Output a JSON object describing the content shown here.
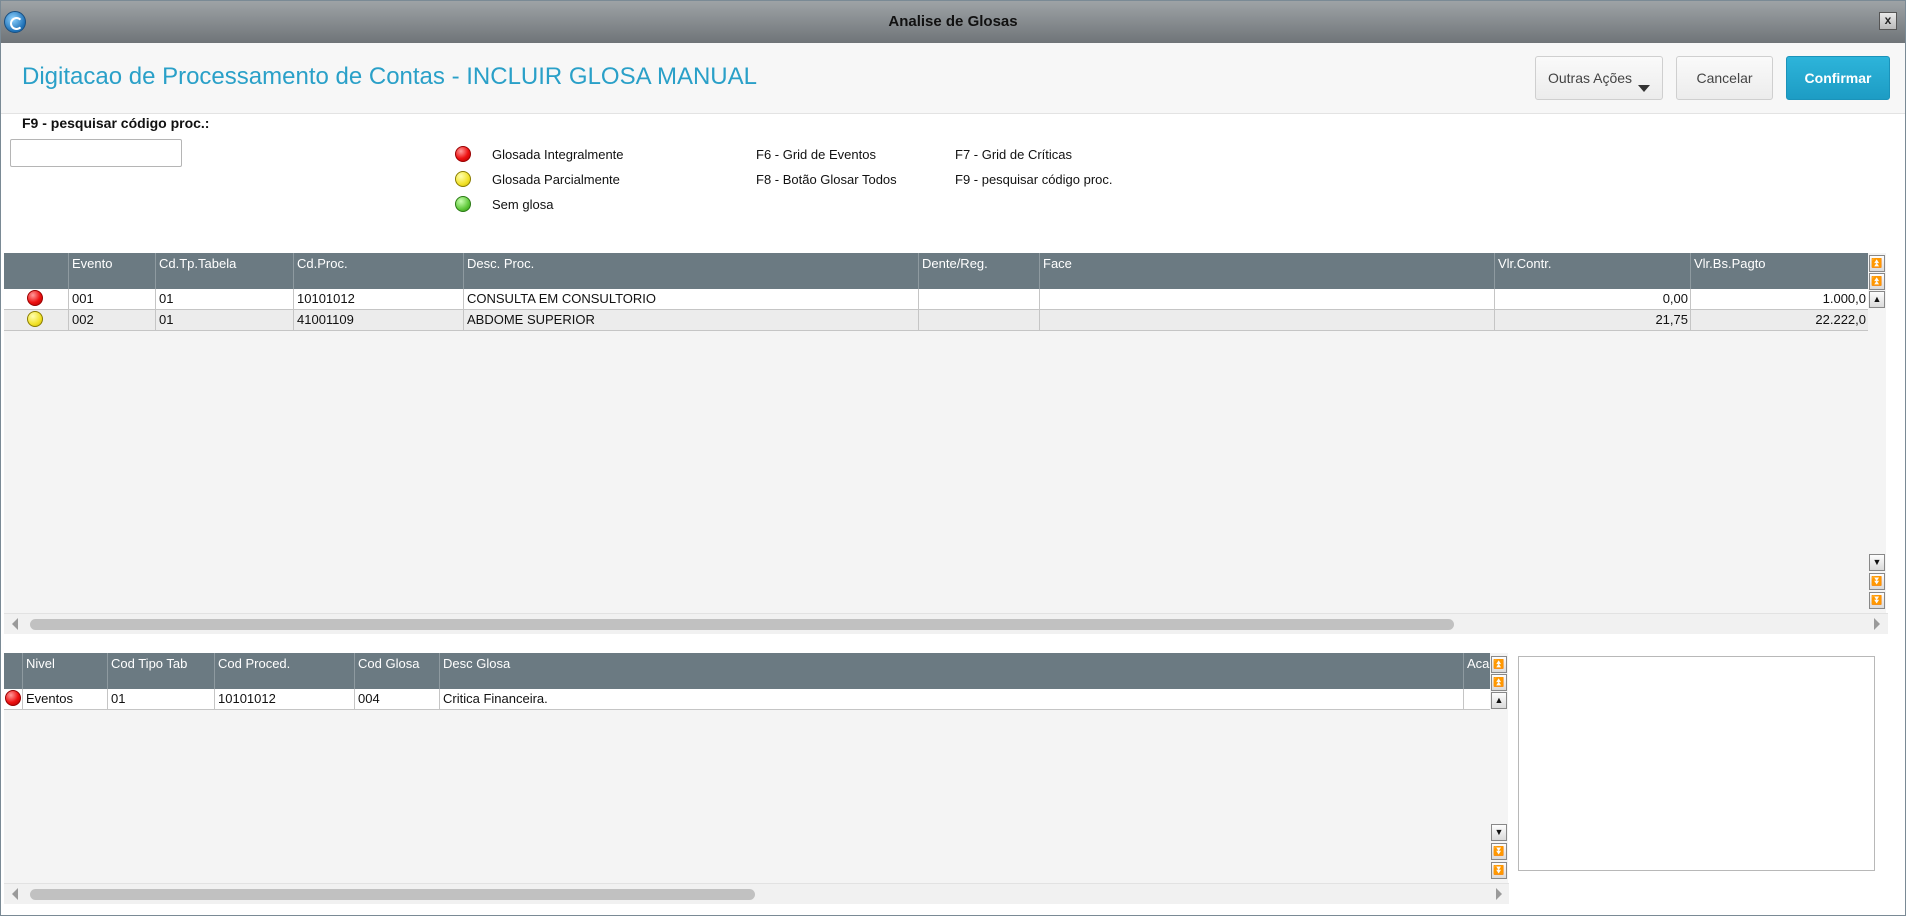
{
  "window": {
    "title": "Analise de Glosas",
    "close_label": "x"
  },
  "header": {
    "page_title": "Digitacao de Processamento de Contas - INCLUIR GLOSA MANUAL",
    "buttons": {
      "outras": "Outras Ações",
      "cancelar": "Cancelar",
      "confirmar": "Confirmar"
    }
  },
  "search": {
    "label": "F9 - pesquisar código proc.:",
    "value": ""
  },
  "legend": {
    "status": [
      {
        "color": "red",
        "label": "Glosada Integralmente"
      },
      {
        "color": "yellow",
        "label": "Glosada Parcialmente"
      },
      {
        "color": "green",
        "label": "Sem glosa"
      }
    ],
    "shortcuts_a": [
      "F6 - Grid de Eventos",
      "F8 - Botão Glosar Todos"
    ],
    "shortcuts_b": [
      "F7 - Grid de Críticas",
      "F9 - pesquisar código proc."
    ]
  },
  "events_grid": {
    "columns": [
      "",
      "Evento",
      "Cd.Tp.Tabela",
      "Cd.Proc.",
      "Desc. Proc.",
      "Dente/Reg.",
      "Face",
      "Vlr.Contr.",
      "Vlr.Bs.Pagto"
    ],
    "rows": [
      {
        "status": "red",
        "evento": "001",
        "cd_tp_tabela": "01",
        "cd_proc": "10101012",
        "desc_proc": "CONSULTA EM CONSULTORIO",
        "dente_reg": "",
        "face": "",
        "vlr_contr": "0,00",
        "vlr_bs_pagto": "1.000,0"
      },
      {
        "status": "yellow",
        "evento": "002",
        "cd_tp_tabela": "01",
        "cd_proc": "41001109",
        "desc_proc": "ABDOME SUPERIOR",
        "dente_reg": "",
        "face": "",
        "vlr_contr": "21,75",
        "vlr_bs_pagto": "22.222,0"
      }
    ]
  },
  "glosas_grid": {
    "columns": [
      "",
      "Nivel",
      "Cod Tipo Tab",
      "Cod Proced.",
      "Cod Glosa",
      "Desc Glosa",
      "Aca"
    ],
    "rows": [
      {
        "status": "red",
        "nivel": "Eventos",
        "cod_tipo_tab": "01",
        "cod_proced": "10101012",
        "cod_glosa": "004",
        "desc_glosa": "Critica Financeira.",
        "acao": ""
      }
    ]
  },
  "memo": {
    "value": ""
  }
}
